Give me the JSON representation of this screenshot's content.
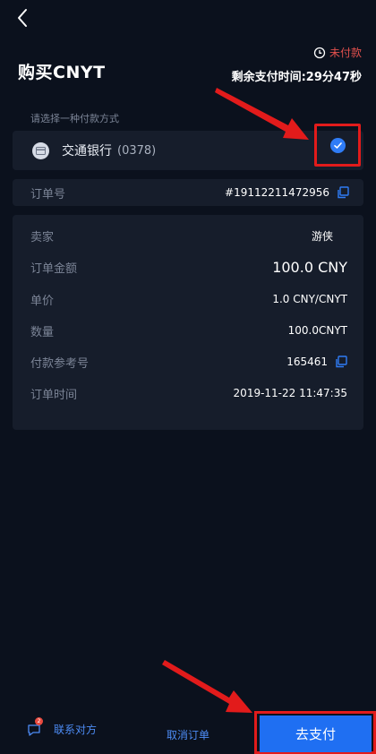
{
  "header": {
    "title": "购买CNYT",
    "status": "未付款",
    "timer": "剩余支付时间:29分47秒"
  },
  "payment": {
    "prompt": "请选择一种付款方式",
    "bank_name": "交通银行",
    "bank_account": "(0378)",
    "selected": true
  },
  "order": {
    "label": "订单号",
    "number": "#19112211472956"
  },
  "details": [
    {
      "label": "卖家",
      "value": "游侠"
    },
    {
      "label": "订单金额",
      "value": "100.0 CNY"
    },
    {
      "label": "单价",
      "value": "1.0 CNY/CNYT"
    },
    {
      "label": "数量",
      "value": "100.0CNYT"
    },
    {
      "label": "付款参考号",
      "value": "165461"
    },
    {
      "label": "订单时间",
      "value": "2019-11-22 11:47:35"
    }
  ],
  "footer": {
    "contact_label": "联系对方",
    "contact_badge": "2",
    "cancel_label": "取消订单",
    "pay_label": "去支付"
  },
  "colors": {
    "background": "#0b111d",
    "card": "#161d2b",
    "accent": "#1f6ff2",
    "status_red": "#e2504d",
    "annotation_red": "#e21b1b"
  },
  "icons": [
    "back-arrow-icon",
    "clock-icon",
    "bank-card-icon",
    "checkmark-icon",
    "copy-icon",
    "chat-icon"
  ]
}
